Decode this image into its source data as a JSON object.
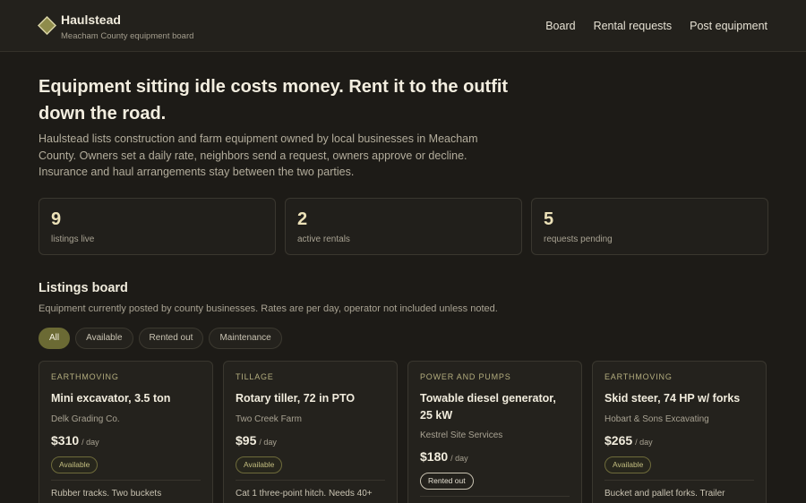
{
  "header": {
    "brand_name": "Haulstead",
    "brand_sub": "Meacham County equipment board",
    "nav": [
      "Board",
      "Rental requests",
      "Post equipment"
    ]
  },
  "hero": {
    "title": "Equipment sitting idle costs money. Rent it to the outfit down the road.",
    "description": "Haulstead lists construction and farm equipment owned by local businesses in Meacham County. Owners set a daily rate, neighbors send a request, owners approve or decline. Insurance and haul arrangements stay between the two parties."
  },
  "stats": [
    {
      "value": "9",
      "label": "listings live"
    },
    {
      "value": "2",
      "label": "active rentals"
    },
    {
      "value": "5",
      "label": "requests pending"
    }
  ],
  "listings": {
    "title": "Listings board",
    "description": "Equipment currently posted by county businesses. Rates are per day, operator not included unless noted.",
    "filters": [
      "All",
      "Available",
      "Rented out",
      "Maintenance"
    ],
    "cards": [
      {
        "category": "Earthmoving",
        "title": "Mini excavator, 3.5 ton",
        "owner": "Delk Grading Co.",
        "rate": "$310",
        "unit": "/ day",
        "status": "Available",
        "note": "Rubber tracks. Two buckets"
      },
      {
        "category": "Tillage",
        "title": "Rotary tiller, 72 in PTO",
        "owner": "Two Creek Farm",
        "rate": "$95",
        "unit": "/ day",
        "status": "Available",
        "note": "Cat 1 three-point hitch. Needs 40+"
      },
      {
        "category": "Power and pumps",
        "title": "Towable diesel generator, 25 kW",
        "owner": "Kestrel Site Services",
        "rate": "$180",
        "unit": "/ day",
        "status": "Rented out",
        "note": ""
      },
      {
        "category": "Earthmoving",
        "title": "Skid steer, 74 HP w/ forks",
        "owner": "Hobart & Sons Excavating",
        "rate": "$265",
        "unit": "/ day",
        "status": "Available",
        "note": "Bucket and pallet forks. Trailer"
      }
    ]
  },
  "colors": {
    "accent": "#6b6a34",
    "background": "#1d1b17",
    "badge_available": "#c4bf80"
  }
}
